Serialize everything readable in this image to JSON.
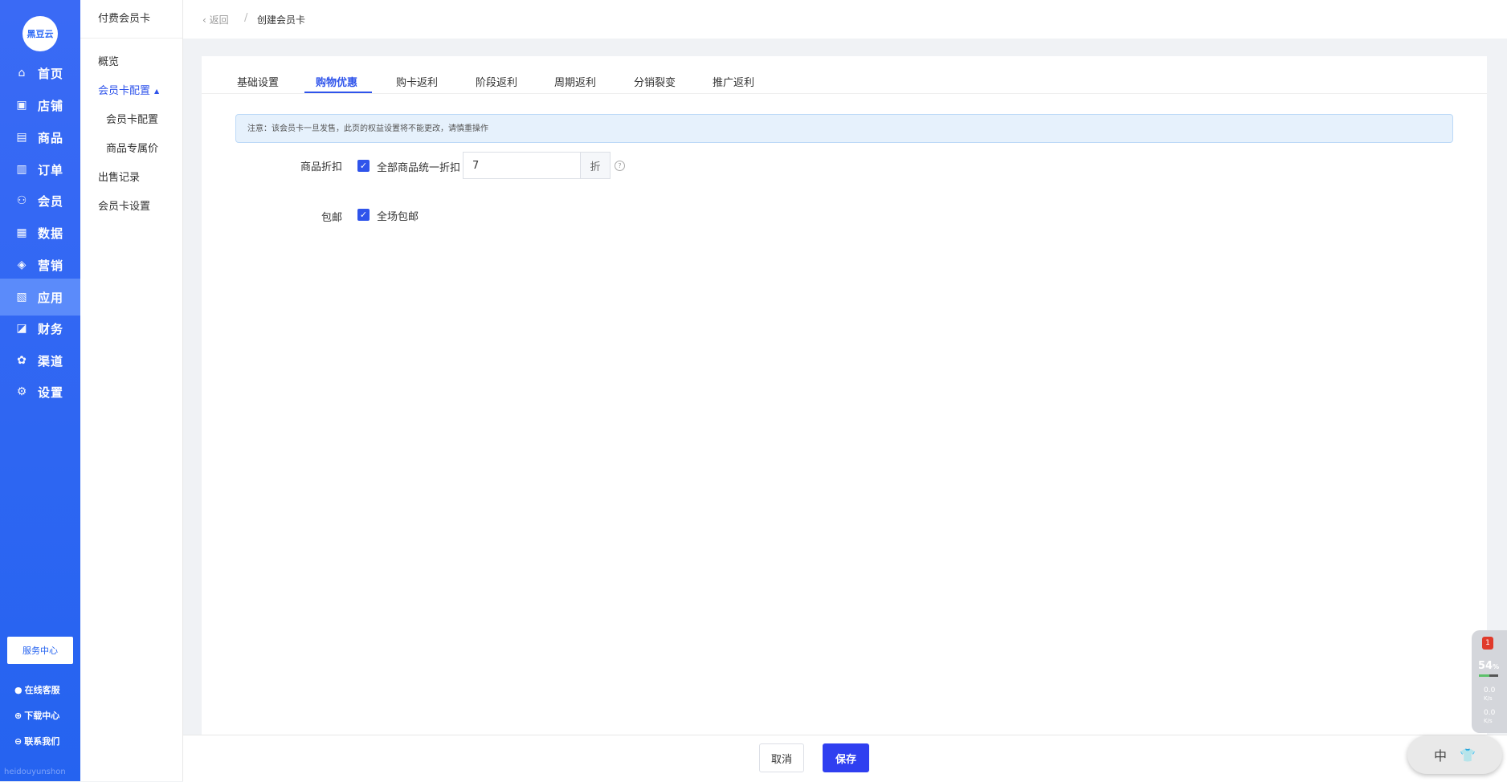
{
  "brand": {
    "logo_text": "黑豆云",
    "footer": "heidouyunshon"
  },
  "nav": {
    "items": [
      {
        "label": "首页",
        "icon": "home-icon",
        "glyph": "⌂"
      },
      {
        "label": "店铺",
        "icon": "store-icon",
        "glyph": "▣"
      },
      {
        "label": "商品",
        "icon": "goods-icon",
        "glyph": "▤"
      },
      {
        "label": "订单",
        "icon": "order-icon",
        "glyph": "▥"
      },
      {
        "label": "会员",
        "icon": "member-icon",
        "glyph": "⚇"
      },
      {
        "label": "数据",
        "icon": "data-icon",
        "glyph": "▦"
      },
      {
        "label": "营销",
        "icon": "marketing-tag-icon",
        "glyph": "◈"
      },
      {
        "label": "应用",
        "icon": "app-icon",
        "glyph": "▧"
      },
      {
        "label": "财务",
        "icon": "finance-icon",
        "glyph": "◪"
      },
      {
        "label": "渠道",
        "icon": "channel-icon",
        "glyph": "✿"
      },
      {
        "label": "设置",
        "icon": "settings-gear-icon",
        "glyph": "⚙"
      }
    ],
    "active_index": 7,
    "service_center": "服务中心",
    "links": [
      {
        "label": "在线客服",
        "icon": "online-service-icon",
        "glyph": "●"
      },
      {
        "label": "下载中心",
        "icon": "download-icon",
        "glyph": "⊕"
      },
      {
        "label": "联系我们",
        "icon": "contact-icon",
        "glyph": "⊖"
      }
    ]
  },
  "subnav": {
    "title": "付费会员卡",
    "overview": "概览",
    "config": "会员卡配置",
    "config_sub1": "会员卡配置",
    "config_sub2": "商品专属价",
    "records": "出售记录",
    "settings": "会员卡设置"
  },
  "header": {
    "back": "返回",
    "separator": "/",
    "current": "创建会员卡"
  },
  "tabs": [
    "基础设置",
    "购物优惠",
    "购卡返利",
    "阶段返利",
    "周期返利",
    "分销裂变",
    "推广返利"
  ],
  "active_tab": 1,
  "notice": "注意：该会员卡一旦发售，此页的权益设置将不能更改，请慎重操作",
  "form": {
    "discount_label": "商品折扣",
    "discount_checkbox": "全部商品统一折扣",
    "discount_value": "7",
    "discount_suffix": "折",
    "shipping_label": "包邮",
    "shipping_checkbox": "全场包邮"
  },
  "footer": {
    "cancel": "取消",
    "save": "保存"
  },
  "monitor": {
    "badge": "1",
    "percent": "54",
    "percent_unit": "%",
    "upload": "0.0",
    "download": "0.0",
    "unit": "K/s",
    "load_fraction": 0.54
  },
  "ime": {
    "mode": "中",
    "skin_icon": "shirt-icon"
  },
  "colors": {
    "nav_bg": "#2563f0",
    "accent": "#2f54eb",
    "save_button": "#2f3ff0"
  }
}
